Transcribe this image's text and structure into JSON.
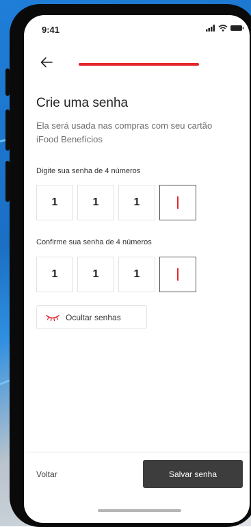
{
  "status_bar": {
    "time": "9:41"
  },
  "header": {
    "progress_fraction": 1.0,
    "progress_color": "#e4252d"
  },
  "content": {
    "title": "Crie uma senha",
    "subtitle": "Ela será usada nas compras com seu cartão iFood Benefícios"
  },
  "pin_entry": {
    "label": "Digite sua senha de 4 números",
    "digits": [
      "1",
      "1",
      "1",
      ""
    ]
  },
  "pin_confirm": {
    "label": "Confirme sua senha de 4 números",
    "digits": [
      "1",
      "1",
      "1",
      ""
    ]
  },
  "toggle": {
    "label": "Ocultar senhas",
    "icon": "closed-eye-icon"
  },
  "footer": {
    "back_label": "Voltar",
    "save_label": "Salvar senha"
  },
  "colors": {
    "accent": "#e4252d",
    "primary_button": "#3d3d3d"
  }
}
